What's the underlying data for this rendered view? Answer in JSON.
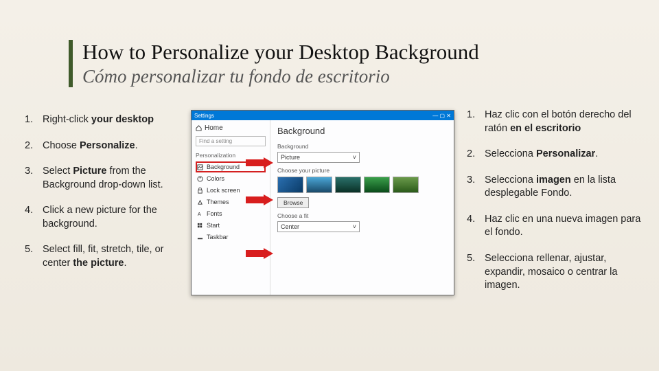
{
  "title": {
    "en": "How to Personalize your Desktop Background",
    "es": "Cómo personalizar tu fondo de escritorio"
  },
  "steps_en": [
    {
      "num": "1.",
      "html": "Right-click <b>your desktop</b>"
    },
    {
      "num": "2.",
      "html": "Choose <b>Personalize</b>."
    },
    {
      "num": "3.",
      "html": "Select <b>Picture</b> from the Background drop-down list."
    },
    {
      "num": "4.",
      "html": "Click a new picture for the background."
    },
    {
      "num": "5.",
      "html": "Select fill, fit, stretch, tile, or center <b>the picture</b>."
    }
  ],
  "steps_es": [
    {
      "num": "1.",
      "html": "Haz clic con el botón derecho del ratón <b>en el escritorio</b>"
    },
    {
      "num": "2.",
      "html": "Selecciona <b>Personalizar</b>."
    },
    {
      "num": "3.",
      "html": "Selecciona <b>imagen</b> en la lista desplegable Fondo."
    },
    {
      "num": "4.",
      "html": "Haz clic en una nueva imagen para el fondo."
    },
    {
      "num": "5.",
      "html": "Selecciona rellenar, ajustar, expandir, mosaico o centrar la imagen."
    }
  ],
  "screenshot": {
    "app_title": "Settings",
    "home": "Home",
    "search_placeholder": "Find a setting",
    "group": "Personalization",
    "items": [
      "Background",
      "Colors",
      "Lock screen",
      "Themes",
      "Fonts",
      "Start",
      "Taskbar"
    ],
    "heading": "Background",
    "label_bg": "Background",
    "dd_bg": "Picture",
    "label_choose": "Choose your picture",
    "browse": "Browse",
    "label_fit": "Choose a fit",
    "dd_fit": "Center"
  }
}
